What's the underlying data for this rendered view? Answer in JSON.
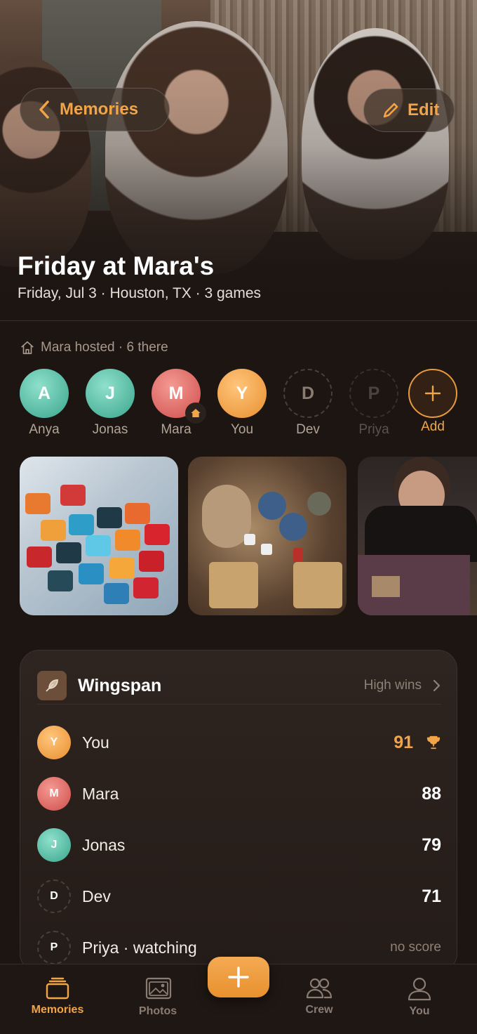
{
  "header": {
    "back_label": "Memories",
    "edit_label": "Edit",
    "title": "Friday at Mara's",
    "subtitle": "Friday, Jul 3 · Houston, TX · 3 games"
  },
  "host_line": "Mara hosted · 6 there",
  "people": [
    {
      "initial": "A",
      "name": "Anya"
    },
    {
      "initial": "J",
      "name": "Jonas"
    },
    {
      "initial": "M",
      "name": "Mara"
    },
    {
      "initial": "Y",
      "name": "You"
    },
    {
      "initial": "D",
      "name": "Dev"
    },
    {
      "initial": "P",
      "name": "Priya"
    }
  ],
  "add_label": "Add",
  "score_card": {
    "game": "Wingspan",
    "rule": "High wins",
    "rows": [
      {
        "initial": "Y",
        "name": "You",
        "score": "91"
      },
      {
        "initial": "M",
        "name": "Mara",
        "score": "88"
      },
      {
        "initial": "J",
        "name": "Jonas",
        "score": "79"
      },
      {
        "initial": "D",
        "name": "Dev",
        "score": "71"
      },
      {
        "initial": "P",
        "name": "Priya · watching",
        "score": "no score"
      }
    ]
  },
  "nav": {
    "memories": "Memories",
    "photos": "Photos",
    "crew": "Crew",
    "you": "You"
  },
  "colors": {
    "accent": "#f2a548",
    "background": "#1c1512"
  }
}
